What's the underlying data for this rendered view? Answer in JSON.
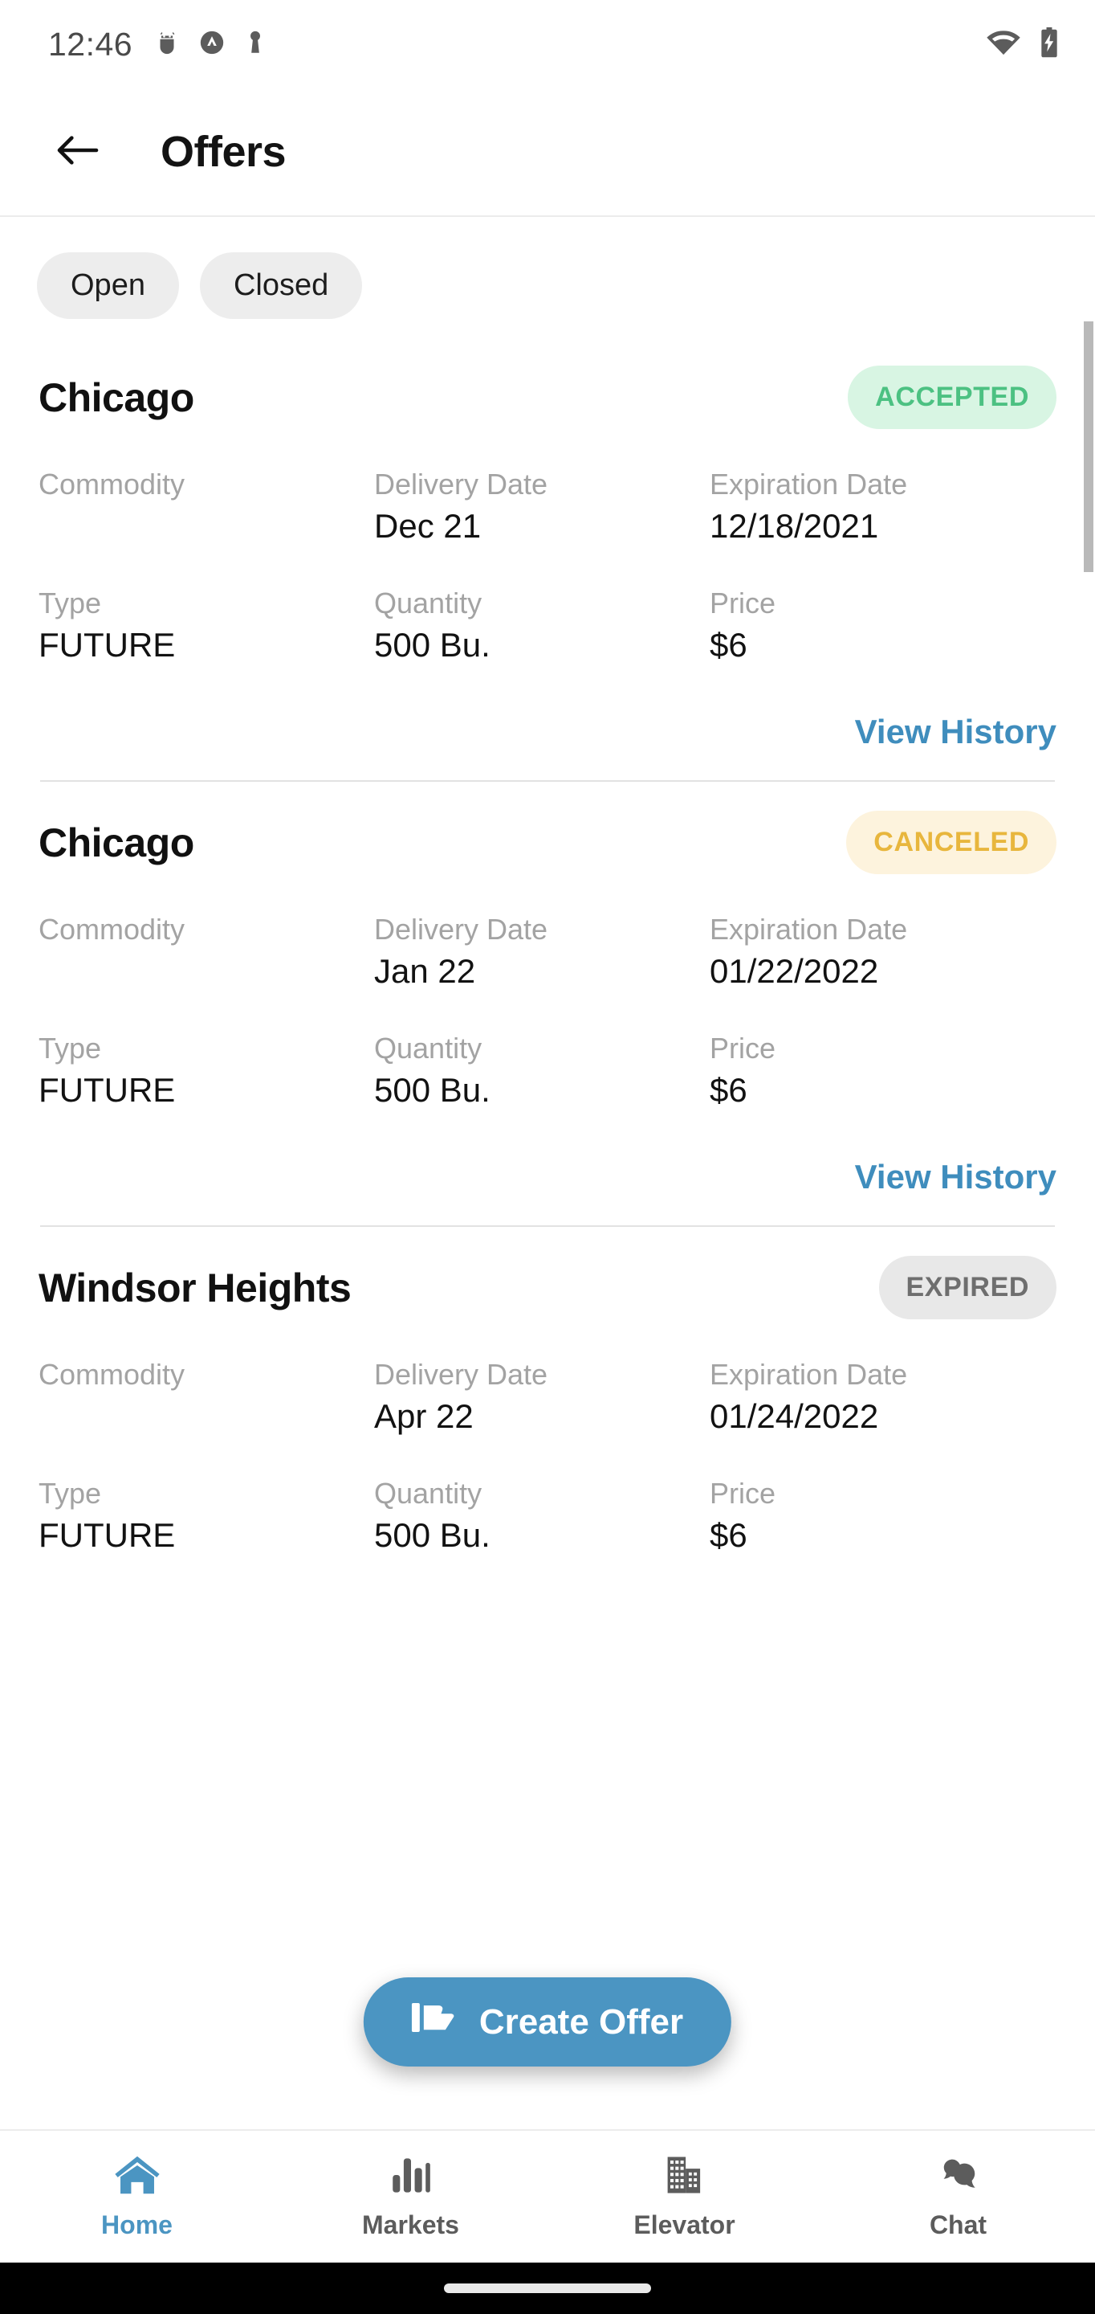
{
  "statusbar": {
    "time": "12:46",
    "left_icons": [
      "android-debug-icon",
      "adaptive-brightness-icon",
      "vpn-key-icon"
    ],
    "right_icons": [
      "wifi-icon",
      "battery-charging-icon"
    ]
  },
  "appbar": {
    "back_icon": "back-arrow-icon",
    "title": "Offers"
  },
  "filters": {
    "chips": [
      {
        "label": "Open"
      },
      {
        "label": "Closed"
      }
    ]
  },
  "labels": {
    "commodity": "Commodity",
    "delivery_date": "Delivery Date",
    "expiration_date": "Expiration Date",
    "type": "Type",
    "quantity": "Quantity",
    "price": "Price",
    "view_history": "View History"
  },
  "offers": [
    {
      "location": "Chicago",
      "status": "ACCEPTED",
      "status_kind": "accepted",
      "commodity": "",
      "delivery_date": "Dec 21",
      "expiration_date": "12/18/2021",
      "type": "FUTURE",
      "quantity": "500 Bu.",
      "price": "$6",
      "view_history": "View History"
    },
    {
      "location": "Chicago",
      "status": "CANCELED",
      "status_kind": "canceled",
      "commodity": "",
      "delivery_date": "Jan 22",
      "expiration_date": "01/22/2022",
      "type": "FUTURE",
      "quantity": "500 Bu.",
      "price": "$6",
      "view_history": "View History"
    },
    {
      "location": "Windsor Heights",
      "status": "EXPIRED",
      "status_kind": "expired",
      "commodity": "",
      "delivery_date": "Apr 22",
      "expiration_date": "01/24/2022",
      "type": "FUTURE",
      "quantity": "500 Bu.",
      "price": "$6",
      "view_history": ""
    }
  ],
  "fab": {
    "label": "Create Offer",
    "icon": "offer-flag-icon",
    "color": "#4b95c2"
  },
  "bottomnav": {
    "items": [
      {
        "label": "Home",
        "icon": "home-icon",
        "active": true
      },
      {
        "label": "Markets",
        "icon": "bar-chart-icon",
        "active": false
      },
      {
        "label": "Elevator",
        "icon": "building-icon",
        "active": false
      },
      {
        "label": "Chat",
        "icon": "chat-bubbles-icon",
        "active": false
      }
    ]
  },
  "colors": {
    "accent": "#4b95c2",
    "link": "#3f8dbd",
    "accepted_text": "#4cc182",
    "accepted_bg": "#d8f5e3",
    "canceled_text": "#e8b63d",
    "canceled_bg": "#fdf3dd",
    "expired_text": "#6e6e6e",
    "expired_bg": "#e8e8e8"
  }
}
